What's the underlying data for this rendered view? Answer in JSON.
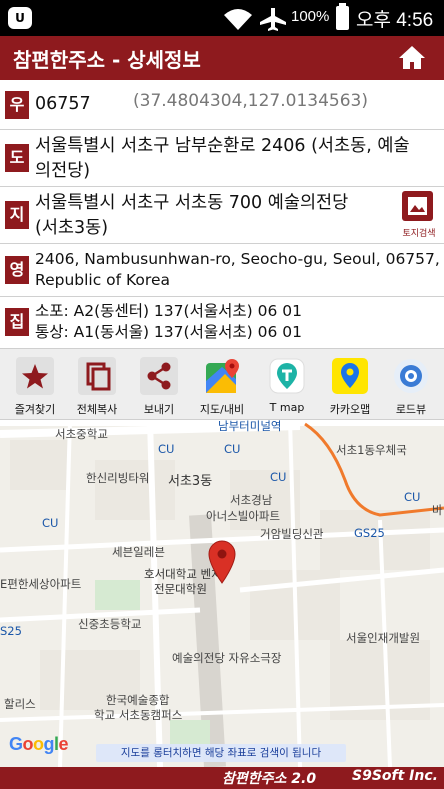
{
  "status_bar": {
    "battery": "100%",
    "time": "오후 4:56"
  },
  "app_bar": {
    "title": "참편한주소 - 상세정보"
  },
  "info": {
    "postal": {
      "badge": "우",
      "code": "06757",
      "coords": "(37.4804304,127.0134563)"
    },
    "road": {
      "badge": "도",
      "line1": "서울특별시 서초구 남부순환로 2406 (서초동, 예술",
      "line2": "의전당)"
    },
    "jibun": {
      "badge": "지",
      "line1": "서울특별시 서초구 서초동 700 예술의전당",
      "line2": "(서초3동)",
      "land_search_label": "토지검색"
    },
    "english": {
      "badge": "영",
      "line1": "2406, Nambusunhwan-ro, Seocho-gu, Seoul, 06757,",
      "line2": "Republic of Korea"
    },
    "delivery": {
      "badge": "집",
      "line1": "소포: A2(동센터) 137(서울서초) 06 01",
      "line2": "통상: A1(동서울) 137(서울서초) 06 01"
    }
  },
  "toolbar": [
    {
      "label": "즐겨찾기",
      "icon": "star-icon"
    },
    {
      "label": "전체복사",
      "icon": "copy-icon"
    },
    {
      "label": "보내기",
      "icon": "share-icon"
    },
    {
      "label": "지도/내비",
      "icon": "google-maps-icon"
    },
    {
      "label": "T map",
      "icon": "tmap-icon"
    },
    {
      "label": "카카오맵",
      "icon": "kakaomap-icon"
    },
    {
      "label": "로드뷰",
      "icon": "roadview-icon"
    }
  ],
  "map": {
    "labels": [
      "서초중학교",
      "남부터미널역",
      "CU",
      "CU",
      "한신리빙타워",
      "서초3동",
      "서초1동우체국",
      "CU",
      "CU",
      "서초경남",
      "아너스빌아파트",
      "CU",
      "거암빌딩신관",
      "GS25",
      "세븐일레븐",
      "호서대학교 벤처",
      "전문대학원",
      "E편한세상아파트",
      "S25",
      "신중초등학교",
      "서울인재개발원",
      "예술의전당 자유소극장",
      "한국예술종합",
      "학교 서초동캠퍼스",
      "할리스",
      "바"
    ],
    "google": "Google",
    "notice": "지도를 롱터치하면 해당 좌표로 검색이 됩니다"
  },
  "footer": {
    "app_name": "참편한주소 2.0",
    "company": "S9Soft Inc."
  },
  "colors": {
    "brand": "#8e1a1e",
    "map_bg": "#f1efe9",
    "pin": "#d93025"
  }
}
